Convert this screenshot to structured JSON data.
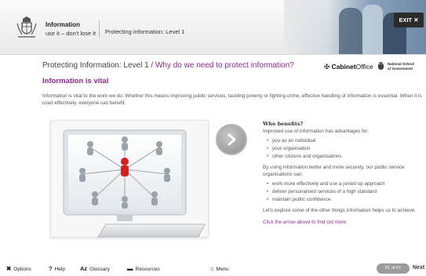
{
  "header": {
    "title_line1": "Information",
    "title_line2": "use it – don't lose it",
    "subtitle": "Protecting information: Level 1",
    "exit_label": "EXIT",
    "exit_icon": "close-icon"
  },
  "main": {
    "breadcrumb_level": "Protecting Information: Level 1 / ",
    "breadcrumb_question": "Why do we need to protect information?",
    "logo_cabinet_prefix": "Cabinet",
    "logo_cabinet_suffix": "Office",
    "logo_ns_line1": "National School",
    "logo_ns_line2": "of Government",
    "heading": "Information is vital",
    "intro": "Information is vital to the work we do. Whether this means improving public services, tackling poverty or fighting crime, effective handling of information is essential. When it is used effectively, everyone can benefit."
  },
  "side": {
    "heading": "Who benefits?",
    "lead": "Improved use of information has advantages for:",
    "benefits": [
      "you as an individual",
      "your organisation",
      "other citizens and organisations"
    ],
    "para2": "By using information better and more securely, our public service organisations can:",
    "actions": [
      "work more effectively and use a joined up approach",
      "deliver personalised services of a high standard",
      "maintain public confidence."
    ],
    "para3": "Let's explore some of the other things information helps us to achieve.",
    "cta": "Click the arrow above to find out more."
  },
  "footer": {
    "options": "Options",
    "help": "Help",
    "glossary": "Glossary",
    "resources": "Resources",
    "menu": "Menu",
    "page": "01 of 07",
    "next": "Next"
  },
  "colors": {
    "accent": "#8a2a8c",
    "exit_bg": "#2b2b2b",
    "badge_bg": "#9b9b9b"
  }
}
